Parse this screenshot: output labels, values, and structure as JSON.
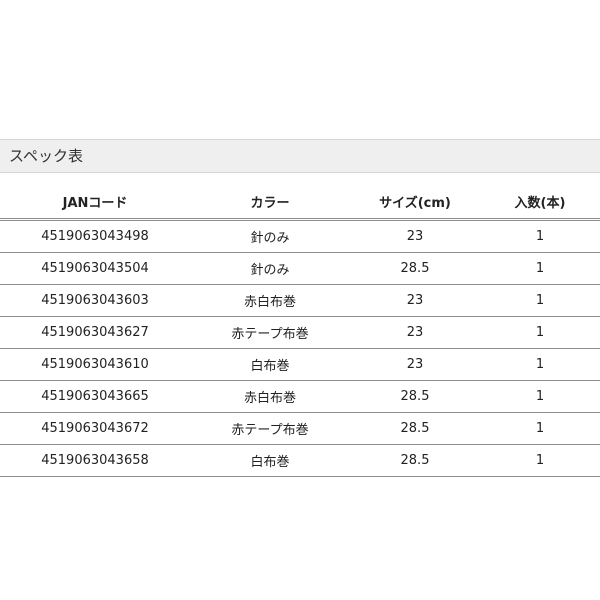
{
  "section": {
    "title": "スペック表"
  },
  "table": {
    "headers": {
      "jan": "JANコード",
      "color": "カラー",
      "size": "サイズ(cm)",
      "qty": "入数(本)"
    },
    "rows": [
      {
        "jan": "4519063043498",
        "color": "針のみ",
        "size": "23",
        "qty": "1"
      },
      {
        "jan": "4519063043504",
        "color": "針のみ",
        "size": "28.5",
        "qty": "1"
      },
      {
        "jan": "4519063043603",
        "color": "赤白布巻",
        "size": "23",
        "qty": "1"
      },
      {
        "jan": "4519063043627",
        "color": "赤テープ布巻",
        "size": "23",
        "qty": "1"
      },
      {
        "jan": "4519063043610",
        "color": "白布巻",
        "size": "23",
        "qty": "1"
      },
      {
        "jan": "4519063043665",
        "color": "赤白布巻",
        "size": "28.5",
        "qty": "1"
      },
      {
        "jan": "4519063043672",
        "color": "赤テープ布巻",
        "size": "28.5",
        "qty": "1"
      },
      {
        "jan": "4519063043658",
        "color": "白布巻",
        "size": "28.5",
        "qty": "1"
      }
    ]
  }
}
